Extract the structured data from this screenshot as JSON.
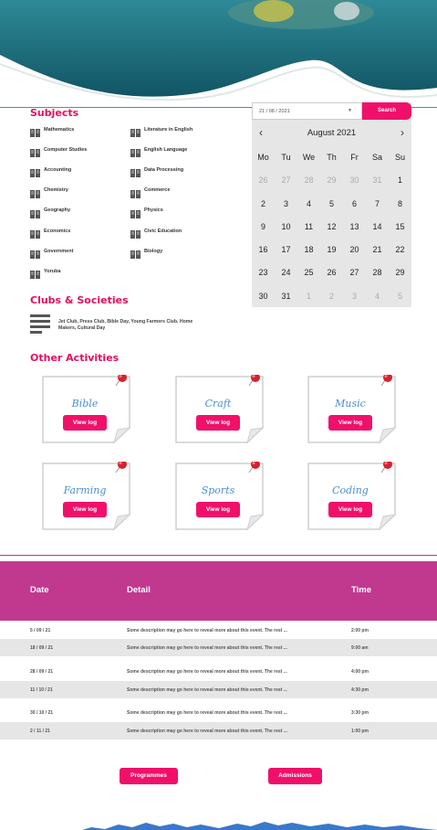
{
  "subjects": {
    "title": "Subjects",
    "left": [
      "Mathematics",
      "Computer Studies",
      "Accounting",
      "Chemistry",
      "Geography",
      "Economics",
      "Government",
      "Yoruba"
    ],
    "right": [
      "Literature in English",
      "English Language",
      "Data Processing",
      "Commerce",
      "Physics",
      "Civic Education",
      "Biology"
    ]
  },
  "datepicker": {
    "value": "21 / 08 / 2021",
    "search_label": "Search",
    "month_label": "August 2021",
    "weekdays": [
      "Mo",
      "Tu",
      "We",
      "Th",
      "Fr",
      "Sa",
      "Su"
    ],
    "weeks": [
      [
        "26",
        "27",
        "28",
        "29",
        "30",
        "31",
        "1"
      ],
      [
        "2",
        "3",
        "4",
        "5",
        "6",
        "7",
        "8"
      ],
      [
        "9",
        "10",
        "11",
        "12",
        "13",
        "14",
        "15"
      ],
      [
        "16",
        "17",
        "18",
        "19",
        "20",
        "21",
        "22"
      ],
      [
        "23",
        "24",
        "25",
        "26",
        "27",
        "28",
        "29"
      ],
      [
        "30",
        "31",
        "1",
        "2",
        "3",
        "4",
        "5"
      ]
    ],
    "muted": [
      [
        0,
        0
      ],
      [
        0,
        1
      ],
      [
        0,
        2
      ],
      [
        0,
        3
      ],
      [
        0,
        4
      ],
      [
        0,
        5
      ],
      [
        5,
        2
      ],
      [
        5,
        3
      ],
      [
        5,
        4
      ],
      [
        5,
        5
      ],
      [
        5,
        6
      ]
    ]
  },
  "clubs": {
    "title": "Clubs & Societies",
    "text": "Jet Club, Press Club, Bible Day, Young Farmers Club, Home Makers, Cultural Day"
  },
  "activities": {
    "title": "Other Activities",
    "button_label": "View log",
    "items": [
      "Bible",
      "Craft",
      "Music",
      "Farming",
      "Sports",
      "Coding"
    ]
  },
  "events": {
    "headers": {
      "date": "Date",
      "detail": "Detail",
      "time": "Time"
    },
    "rows": [
      {
        "date": "5 / 09 / 21",
        "detail": "Some description may go here to reveal more about this event. The rest ...",
        "time": "2:00 pm"
      },
      {
        "date": "18 / 09 / 21",
        "detail": "Some description may go here to reveal more about this event. The rest ...",
        "time": "9:00 am"
      },
      {
        "date": "28 / 09 / 21",
        "detail": "Some description may go here to reveal more about this event. The rest ...",
        "time": "4:00 pm"
      },
      {
        "date": "11 / 10 / 21",
        "detail": "Some description may go here to reveal more about this event. The rest ...",
        "time": "4:30 pm"
      },
      {
        "date": "30 / 10 / 21",
        "detail": "Some description may go here to reveal more about this event. The rest ...",
        "time": "3:30 pm"
      },
      {
        "date": "2 / 11 / 21",
        "detail": "Some description may go here to reveal more about this event. The rest ...",
        "time": "1:00 pm"
      }
    ]
  },
  "footer": {
    "programmes_label": "Programmes",
    "admissions_label": "Admissions"
  },
  "colors": {
    "accent": "#f0106a",
    "title": "#e0105f",
    "table_header": "#c0398f",
    "teal": "#1b6a7a"
  }
}
